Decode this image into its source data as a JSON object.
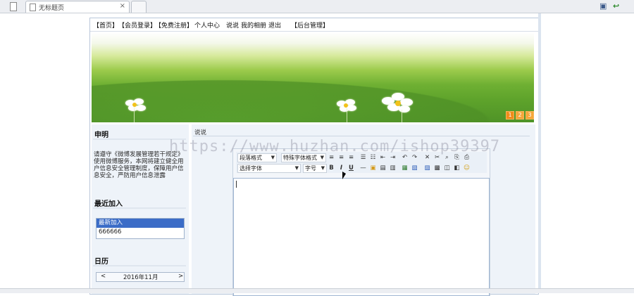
{
  "browser": {
    "tab_title": "无标题页",
    "tab_close": "×",
    "icons": [
      "page-icon",
      "save-icon",
      "back-arrow-icon"
    ]
  },
  "nav": {
    "items": [
      "【首页】",
      "【会员登录】",
      "【免费注册】",
      "个人中心",
      "说说",
      "我的相册",
      "退出",
      "【后台管理】"
    ]
  },
  "banner": {
    "pages": [
      "1",
      "2",
      "3"
    ],
    "accent": "#f08c1a"
  },
  "sidebar": {
    "notice_title": "申明",
    "notice_text": "请遵守《微博发展管理若干规定》使用微博服务，本网将建立健全用户信息安全管理制度，保障用户信息安全，严防用户信息泄露",
    "latest_title": "最近加入",
    "latest_header": "最新加入",
    "latest_item": "666666",
    "calendar_title": "日历",
    "calendar_prev": "<",
    "calendar_month": "2016年11月",
    "calendar_next": ">"
  },
  "content": {
    "breadcrumb": "说说"
  },
  "editor": {
    "paragraph_format": "段落格式",
    "special_format": "特殊字体格式",
    "font_select": "选择字体",
    "font_size": "字号",
    "row1_buttons": [
      "≡",
      "≡",
      "≡",
      "☰",
      "☷",
      "⇤",
      "⇥",
      "↶",
      "↷",
      "✕",
      "✂",
      "⌕",
      "⎘",
      "⎙"
    ],
    "row2_buttons": [
      "B",
      "I",
      "U",
      "—",
      "▣",
      "▤",
      "▥",
      "▦",
      "▧",
      "▨",
      "▩",
      "◫",
      "◧",
      "☺"
    ]
  },
  "watermark": "https://www.huzhan.com/ishop39397"
}
